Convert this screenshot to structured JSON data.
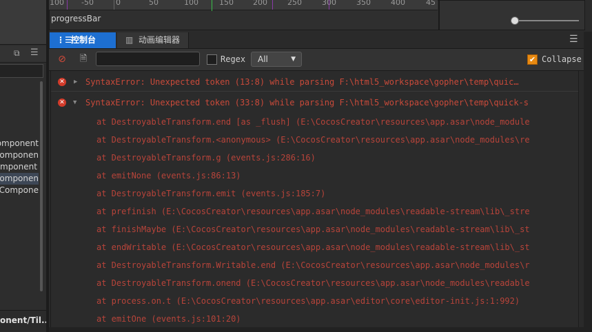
{
  "left_panel": {
    "items": [
      "omponent",
      "omponen",
      "mponent",
      "Componen",
      "Compone"
    ],
    "footer": "onent/Til..."
  },
  "timeline": {
    "ticks": [
      "100",
      "-50",
      "0",
      "50",
      "100",
      "150",
      "200",
      "250",
      "300",
      "350",
      "400",
      "45"
    ],
    "track_label": "progressBar"
  },
  "tabs": {
    "console_label": "控制台",
    "animation_label": "动画编辑器"
  },
  "toolbar": {
    "filter_value": "",
    "regex_label": "Regex",
    "level_value": "All",
    "collapse_label": "Collapse",
    "collapse_checked": true
  },
  "log": {
    "entries": [
      {
        "text": "SyntaxError: Unexpected token (13:8) while parsing F:\\html5_workspace\\gopher\\temp\\quic…",
        "expanded": false
      },
      {
        "text": "SyntaxError: Unexpected token (33:8) while parsing F:\\html5_workspace\\gopher\\temp\\quick-s",
        "expanded": true
      }
    ],
    "stack": [
      "at DestroyableTransform.end [as _flush] (E:\\CocosCreator\\resources\\app.asar\\node_module",
      "at DestroyableTransform.<anonymous> (E:\\CocosCreator\\resources\\app.asar\\node_modules\\re",
      "at DestroyableTransform.g  (events.js:286:16)",
      "at emitNone  (events.js:86:13)",
      "at DestroyableTransform.emit  (events.js:185:7)",
      "at prefinish (E:\\CocosCreator\\resources\\app.asar\\node_modules\\readable-stream\\lib\\_stre",
      "at finishMaybe (E:\\CocosCreator\\resources\\app.asar\\node_modules\\readable-stream\\lib\\_st",
      "at endWritable (E:\\CocosCreator\\resources\\app.asar\\node_modules\\readable-stream\\lib\\_st",
      "at DestroyableTransform.Writable.end (E:\\CocosCreator\\resources\\app.asar\\node_modules\\r",
      "at DestroyableTransform.onend (E:\\CocosCreator\\resources\\app.asar\\node_modules\\readable",
      "at process.on.t (E:\\CocosCreator\\resources\\app.asar\\editor\\core\\editor-init.js:1:992)",
      "at emitOne  (events.js:101:20)"
    ]
  },
  "colors": {
    "accent": "#1d6fd1",
    "error": "#d23b2a",
    "log_text": "#c94a3a",
    "checkbox": "#e88a12"
  }
}
